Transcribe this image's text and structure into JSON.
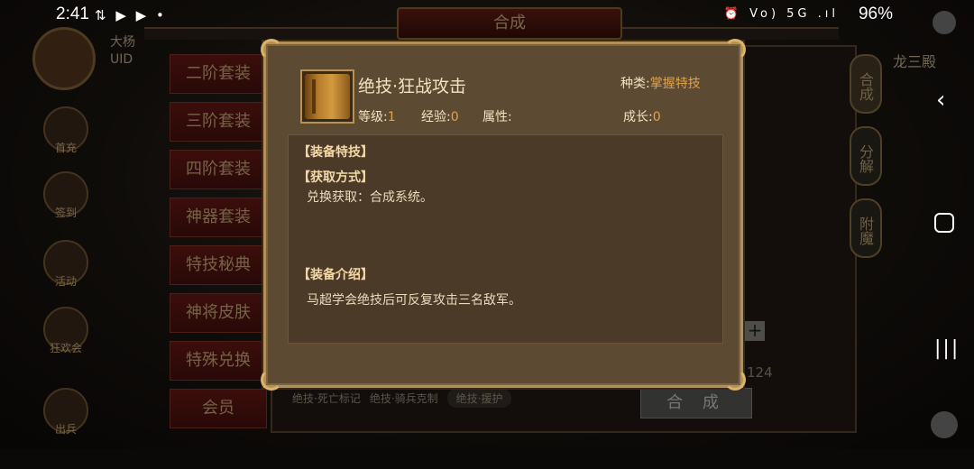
{
  "status_bar": {
    "time": "2:41",
    "left_icons": "⇅ ▶ ▶ •",
    "right_icons": "⏰ Vo) 5G .ıl",
    "battery": "96%"
  },
  "game": {
    "top_title": "合成",
    "player_name": "大杨",
    "uid_label": "UID",
    "right_name": "龙三殿",
    "left_buttons": [
      "首充",
      "签到",
      "活动",
      "狂欢会",
      "出兵"
    ],
    "side_menu": [
      "二阶套装",
      "三阶套装",
      "四阶套装",
      "神器套装",
      "特技秘典",
      "神将皮肤",
      "特殊兑换",
      "会员"
    ],
    "right_tabs": [
      "合成",
      "分解",
      "附魔"
    ],
    "bottom_skills": [
      "绝技·死亡标记",
      "绝技·骑兵克制",
      "绝技·援护"
    ],
    "compose_button": "合 成",
    "plus": "+",
    "count": "124"
  },
  "popup": {
    "item_name": "绝技·狂战攻击",
    "kind_label": "种类:",
    "kind_value": "掌握特技",
    "level_label": "等级:",
    "level_value": "1",
    "exp_label": "经验:",
    "exp_value": "0",
    "attr_label": "属性:",
    "growth_label": "成长:",
    "growth_value": "0",
    "sections": {
      "equip_skill_title": "【装备特技】",
      "obtain_title": "【获取方式】",
      "obtain_text": "兑换获取：合成系统。",
      "intro_title": "【装备介绍】",
      "intro_text": "马超学会绝技后可反复攻击三名敌军。"
    }
  },
  "nav": {
    "back": "‹",
    "recent": "|||"
  }
}
